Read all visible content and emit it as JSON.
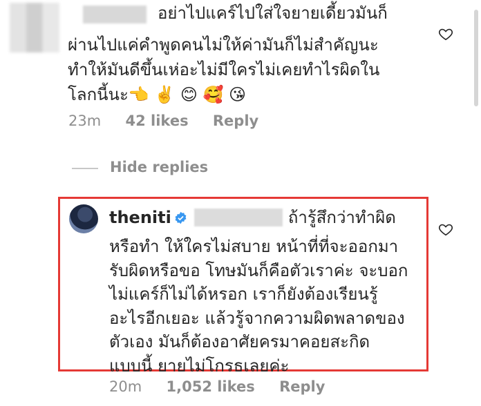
{
  "top_comment": {
    "lines": [
      "อย่าไปแคร์ไปใส่ใจยายเดี้ยวมันก็",
      "ผ่านไปแค่คำพูดคนไม่ให้ค่ามันก็ไม่สำคัญนะ",
      "ทำให้มันดีขึ้นเห่อะไม่มีใครไม่เคยทำไรผิดใน",
      "โลกนี้นะ👈 ✌️ 😊 🥰 😘"
    ],
    "time": "23m",
    "likes": "42 likes",
    "reply": "Reply"
  },
  "hide_replies": "Hide replies",
  "reply_comment": {
    "username": "theniti",
    "first_line_text": "ถ้ารู้สึกว่าทำผิด",
    "lines": [
      "หรือทำ ให้ใครไม่สบาย  หน้าที่ที่จะออกมา",
      "รับผิดหรือขอ โทษมันก็คือตัวเราค่ะ  จะบอก",
      "ไม่แคร์ก็ไม่ได้หรอก  เราก็ยังต้องเรียนรู้",
      "อะไรอีกเยอะ  แล้วรู้จากความผิดพลาดของ",
      "ตัวเอง  มันก็ต้องอาศัยครมาคอยสะกิด",
      "แบบนี้  ยายไม่โกรธเลยค่ะ"
    ],
    "time": "20m",
    "likes": "1,052 likes",
    "reply": "Reply"
  },
  "colors": {
    "text": "#262626",
    "meta": "#8e8e8e",
    "highlight_border": "#e53935",
    "verified": "#3897f0"
  }
}
